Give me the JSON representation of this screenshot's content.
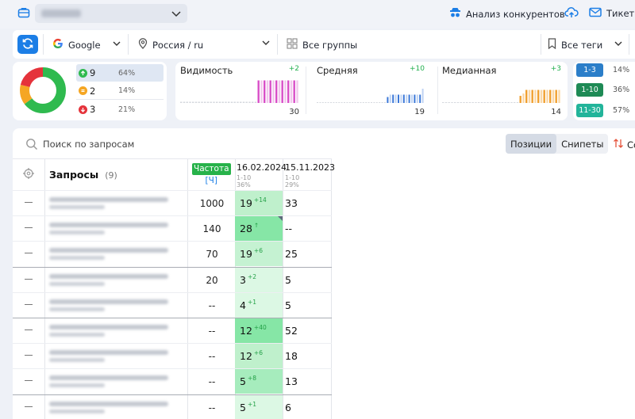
{
  "topbar": {
    "competitors_label": "Анализ конкурентов",
    "tickets_label": "Тикеты"
  },
  "filters": {
    "engine": "Google",
    "region": "Россия / ru",
    "groups": "Все группы",
    "tags": "Все теги"
  },
  "summary": {
    "donut": [
      {
        "label": "up",
        "value": 64,
        "color": "#2fba4f"
      },
      {
        "label": "same",
        "value": 14,
        "color": "#f5a623"
      },
      {
        "label": "down",
        "value": 21,
        "color": "#e5333b"
      }
    ],
    "up": {
      "count": "9",
      "pct": "64%"
    },
    "same": {
      "count": "2",
      "pct": "14%"
    },
    "down": {
      "count": "3",
      "pct": "21%"
    }
  },
  "metrics": [
    {
      "label": "Видимость",
      "delta": "+2",
      "value": "30",
      "color": "#d94fc8",
      "light": "#f1c7ec",
      "bars": [
        0.05,
        0.05,
        0.05,
        0.05,
        0.05,
        0.05,
        0.05,
        0.05,
        0.05,
        0.05,
        0.05,
        0.05,
        0.05,
        0.05,
        0.05,
        0.05,
        0.05,
        0.05,
        0.05,
        0.05,
        0.05,
        0.05,
        0.05,
        0.05,
        0.05,
        0.05,
        0.95,
        0.95,
        0.95,
        0.95,
        0.95,
        0.95,
        0.95,
        0.95,
        0.95,
        0.95,
        0.95,
        0.95,
        0.95,
        0.95
      ]
    },
    {
      "label": "Средняя",
      "delta": "+10",
      "value": "19",
      "color": "#3b78d8",
      "light": "#bfd3f2",
      "bars": [
        0.02,
        0.02,
        0.02,
        0.02,
        0.02,
        0.02,
        0.02,
        0.02,
        0.02,
        0.02,
        0.02,
        0.02,
        0.02,
        0.02,
        0.02,
        0.02,
        0.02,
        0.02,
        0.02,
        0.02,
        0.02,
        0.02,
        0.02,
        0.02,
        0.02,
        0.02,
        0.25,
        0.35,
        0.35,
        0.35,
        0.35,
        0.35,
        0.35,
        0.35,
        0.35,
        0.35,
        0.35,
        0.35,
        0.35,
        0.6
      ]
    },
    {
      "label": "Медианная",
      "delta": "+3",
      "value": "14",
      "color": "#f0a030",
      "light": "#fad8a8",
      "bars": [
        0.02,
        0.02,
        0.02,
        0.02,
        0.02,
        0.02,
        0.02,
        0.02,
        0.02,
        0.02,
        0.02,
        0.02,
        0.02,
        0.02,
        0.02,
        0.02,
        0.02,
        0.02,
        0.02,
        0.02,
        0.02,
        0.02,
        0.02,
        0.02,
        0.02,
        0.02,
        0.3,
        0.4,
        0.55,
        0.55,
        0.55,
        0.55,
        0.55,
        0.55,
        0.55,
        0.55,
        0.55,
        0.55,
        0.55,
        0.55
      ]
    }
  ],
  "ranges": [
    {
      "label": "1-3",
      "pct": "14%",
      "color": "#2b7ec9"
    },
    {
      "label": "1-10",
      "pct": "36%",
      "color": "#1e8a55"
    },
    {
      "label": "11-30",
      "pct": "57%",
      "color": "#22b49a"
    }
  ],
  "main": {
    "search_placeholder": "Поиск по запросам",
    "tab_positions": "Позиции",
    "tab_snippets": "Снипеты",
    "sort_label": "Со"
  },
  "table": {
    "queries_header": "Запросы",
    "queries_count": "(9)",
    "freq_header": "Частота",
    "freq_sub": "[Ч]",
    "date1": "16.02.2024",
    "date1_sub": "1-10",
    "date1_pct": "36%",
    "date2": "15.11.2023",
    "date2_sub": "1-10",
    "date2_pct": "29%",
    "rows": [
      {
        "freq": "1000",
        "pos1": "19",
        "delta": "+14",
        "pos2": "33",
        "shade": "#bff0cc"
      },
      {
        "freq": "140",
        "pos1": "28",
        "delta": "↑",
        "pos2": "--",
        "shade": "#86e6a6"
      },
      {
        "freq": "70",
        "pos1": "19",
        "delta": "+6",
        "pos2": "25",
        "shade": "#c5f2d2"
      },
      {
        "freq": "20",
        "pos1": "3",
        "delta": "+2",
        "pos2": "5",
        "shade": "#dcf8e4"
      },
      {
        "freq": "--",
        "pos1": "4",
        "delta": "+1",
        "pos2": "5",
        "shade": "#dcf8e4"
      },
      {
        "freq": "--",
        "pos1": "12",
        "delta": "+40",
        "pos2": "52",
        "shade": "#86e6a6"
      },
      {
        "freq": "--",
        "pos1": "12",
        "delta": "+6",
        "pos2": "18",
        "shade": "#bff0cc"
      },
      {
        "freq": "--",
        "pos1": "5",
        "delta": "+8",
        "pos2": "13",
        "shade": "#a6ecbd"
      },
      {
        "freq": "--",
        "pos1": "5",
        "delta": "+1",
        "pos2": "6",
        "shade": "#dcf8e4"
      }
    ]
  }
}
